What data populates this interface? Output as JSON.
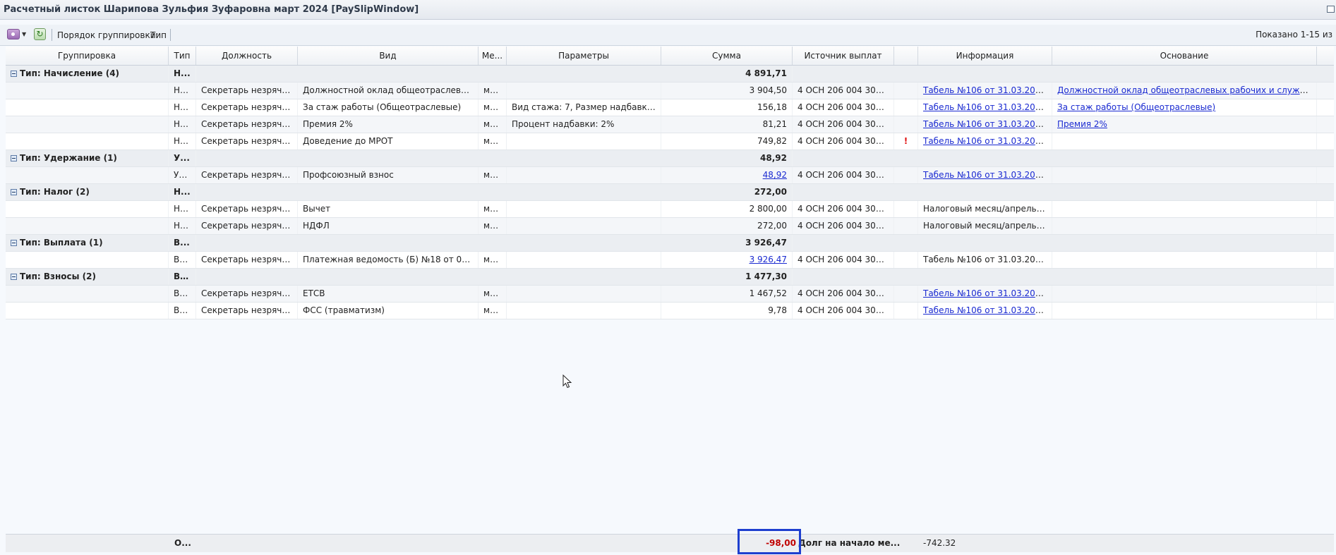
{
  "window": {
    "title": "Расчетный листок Шарипова Зульфия Зуфаровна март 2024 [PaySlipWindow]"
  },
  "toolbar": {
    "grouping_label": "Порядок группировки:",
    "grouping_value": "Тип",
    "shown_count": "Показано 1-15 из"
  },
  "columns": [
    "Группировка",
    "Тип",
    "Должность",
    "Вид",
    "Ме...",
    "Параметры",
    "Сумма",
    "Источник выплат",
    "",
    "Информация",
    "Основание"
  ],
  "groups": [
    {
      "label": "Тип: Начисление (4)",
      "type": "Н...",
      "sum": "4 891,71",
      "rows": [
        {
          "type": "На...",
          "position": "Секретарь незрячего...",
          "kind": "Должностной оклад общеотраслевых ра...",
          "me": "ма...",
          "params": "",
          "sum": "3 904,50",
          "sum_link": false,
          "source": "4 ОСН 206 004 30211",
          "flag": "",
          "info": "Табель №106 от 31.03.2024 (...",
          "info_link": true,
          "basis": "Должностной оклад общеотраслевых рабочих и служащих",
          "basis_link": true
        },
        {
          "type": "На...",
          "position": "Секретарь незрячего...",
          "kind": "За стаж работы (Общеотраслевые)",
          "me": "ма...",
          "params": "Вид стажа: 7, Размер надбавки (...",
          "sum": "156,18",
          "sum_link": false,
          "source": "4 ОСН 206 004 30211",
          "flag": "",
          "info": "Табель №106 от 31.03.2024 (...",
          "info_link": true,
          "basis": "За стаж работы (Общеотраслевые)",
          "basis_link": true
        },
        {
          "type": "На...",
          "position": "Секретарь незрячего...",
          "kind": "Премия 2%",
          "me": "ма...",
          "params": "Процент надбавки: 2%",
          "sum": "81,21",
          "sum_link": false,
          "source": "4 ОСН 206 004 30211",
          "flag": "",
          "info": "Табель №106 от 31.03.2024 (...",
          "info_link": true,
          "basis": "Премия 2%",
          "basis_link": true
        },
        {
          "type": "На...",
          "position": "Секретарь незрячего...",
          "kind": "Доведение до МРОТ",
          "me": "ма...",
          "params": "",
          "sum": "749,82",
          "sum_link": false,
          "source": "4 ОСН 206 004 30211",
          "flag": "!",
          "info": "Табель №106 от 31.03.2024 (...",
          "info_link": true,
          "basis": "",
          "basis_link": false
        }
      ]
    },
    {
      "label": "Тип: Удержание (1)",
      "type": "У...",
      "sum": "48,92",
      "rows": [
        {
          "type": "Уд...",
          "position": "Секретарь незрячего...",
          "kind": "Профсоюзный взнос",
          "me": "ма...",
          "params": "",
          "sum": "48,92",
          "sum_link": true,
          "source": "4 ОСН 206 004 30211",
          "flag": "",
          "info": "Табель №106 от 31.03.2024 (...",
          "info_link": true,
          "basis": "",
          "basis_link": false
        }
      ]
    },
    {
      "label": "Тип: Налог (2)",
      "type": "Н...",
      "sum": "272,00",
      "rows": [
        {
          "type": "На...",
          "position": "Секретарь незрячего...",
          "kind": "Вычет",
          "me": "ма...",
          "params": "",
          "sum": "2 800,00",
          "sum_link": false,
          "source": "4 ОСН 206 004 30211",
          "flag": "",
          "info": "Налоговый месяц/апрель(202...",
          "info_link": false,
          "basis": "",
          "basis_link": false
        },
        {
          "type": "На...",
          "position": "Секретарь незрячего...",
          "kind": "НДФЛ",
          "me": "ма...",
          "params": "",
          "sum": "272,00",
          "sum_link": false,
          "source": "4 ОСН 206 004 30211",
          "flag": "",
          "info": "Налоговый месяц/апрель(202...",
          "info_link": false,
          "basis": "",
          "basis_link": false
        }
      ]
    },
    {
      "label": "Тип: Выплата (1)",
      "type": "В...",
      "sum": "3 926,47",
      "rows": [
        {
          "type": "Вы...",
          "position": "Секретарь незрячего...",
          "kind": "Платежная ведомость (Б) №18 от 03.04....",
          "me": "ма...",
          "params": "",
          "sum": "3 926,47",
          "sum_link": true,
          "source": "4 ОСН 206 004 30211",
          "flag": "",
          "info": "Табель №106 от 31.03.2024 (...",
          "info_link": false,
          "basis": "",
          "basis_link": false
        }
      ]
    },
    {
      "label": "Тип: Взносы (2)",
      "type": "Вз...",
      "sum": "1 477,30",
      "rows": [
        {
          "type": "Вз...",
          "position": "Секретарь незрячего...",
          "kind": "ЕТСВ",
          "me": "ма...",
          "params": "",
          "sum": "1 467,52",
          "sum_link": false,
          "source": "4 ОСН 206 004 30211",
          "flag": "",
          "info": "Табель №106 от 31.03.2024 (...",
          "info_link": true,
          "basis": "",
          "basis_link": false
        },
        {
          "type": "Вз...",
          "position": "Секретарь незрячего...",
          "kind": "ФСС (травматизм)",
          "me": "ма...",
          "params": "",
          "sum": "9,78",
          "sum_link": false,
          "source": "4 ОСН 206 004 30211",
          "flag": "",
          "info": "Табель №106 от 31.03.2024 (...",
          "info_link": true,
          "basis": "",
          "basis_link": false
        }
      ]
    }
  ],
  "footer": {
    "type": "О...",
    "total": "-98,00",
    "total_color": "#c00000",
    "debt_label": "Долг на начало ме...",
    "debt_value": "-742.32"
  },
  "icons": {
    "settings": "settings-icon",
    "refresh": "refresh-icon",
    "collapse": "collapse-icon",
    "warning": "warning-icon",
    "cursor": "mouse-cursor-icon"
  }
}
